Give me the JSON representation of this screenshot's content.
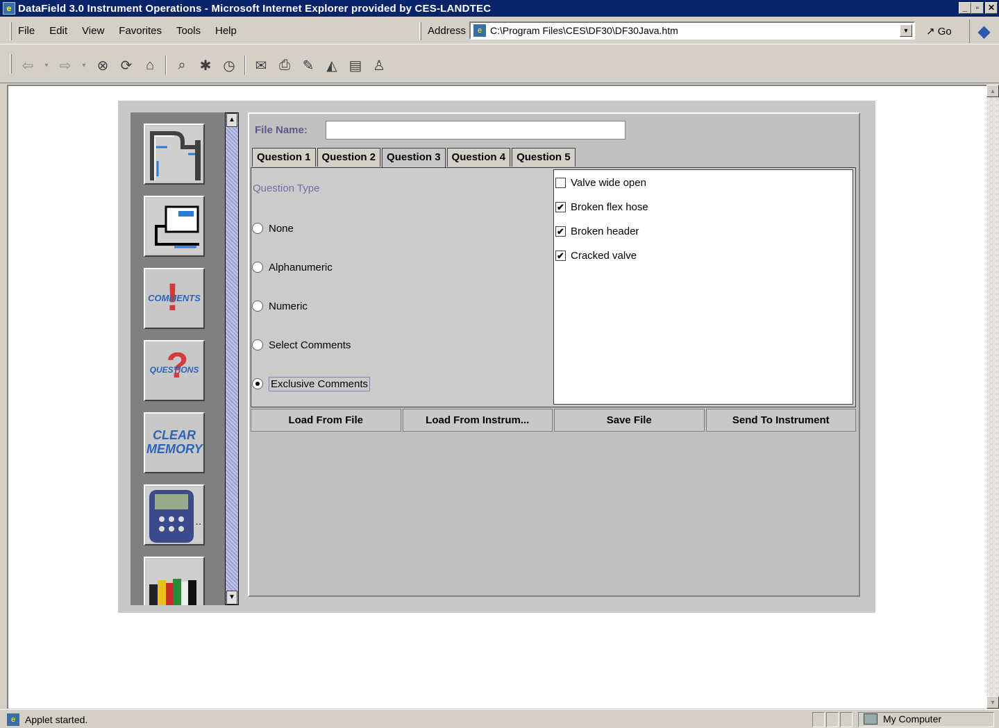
{
  "window": {
    "title": "DataField 3.0 Instrument Operations - Microsoft Internet Explorer provided by CES-LANDTEC",
    "buttons": [
      "_",
      "▫",
      "✕"
    ]
  },
  "menu": {
    "items": [
      "File",
      "Edit",
      "View",
      "Favorites",
      "Tools",
      "Help"
    ]
  },
  "address": {
    "label": "Address",
    "value": "C:\\Program Files\\CES\\DF30\\DF30Java.htm",
    "go_label": "Go"
  },
  "toolbar": {
    "icons": [
      "back-icon",
      "forward-icon",
      "stop-icon",
      "refresh-icon",
      "home-icon",
      "search-icon",
      "favorites-icon",
      "history-icon",
      "mail-icon",
      "print-icon",
      "edit-icon",
      "discuss-icon",
      "messenger-icon",
      "user-icon"
    ]
  },
  "sidebar": {
    "items": [
      {
        "icon": "pipe-diagram-icon",
        "label": ""
      },
      {
        "icon": "monitor-pipe-icon",
        "label": ""
      },
      {
        "icon": "comments-icon",
        "label": "COMMENTS"
      },
      {
        "icon": "questions-icon",
        "label": "QUESTIONS"
      },
      {
        "icon": "clear-memory-icon",
        "label": "CLEAR MEMORY"
      },
      {
        "icon": "instrument-device-icon",
        "label": ""
      },
      {
        "icon": "books-icon",
        "label": ""
      }
    ]
  },
  "form": {
    "file_name_label": "File Name:",
    "file_name_value": "",
    "tabs": [
      "Question 1",
      "Question 2",
      "Question 3",
      "Question 4",
      "Question 5"
    ],
    "active_tab": "Question 3",
    "question_type_label": "Question Type",
    "question_types": [
      {
        "label": "None",
        "checked": false
      },
      {
        "label": "Alphanumeric",
        "checked": false
      },
      {
        "label": "Numeric",
        "checked": false
      },
      {
        "label": "Select Comments",
        "checked": false
      },
      {
        "label": "Exclusive Comments",
        "checked": true
      }
    ],
    "comments": [
      {
        "label": "Valve wide open",
        "checked": false
      },
      {
        "label": "Broken flex hose",
        "checked": true
      },
      {
        "label": "Broken header",
        "checked": true
      },
      {
        "label": "Cracked valve",
        "checked": true
      }
    ],
    "actions": [
      "Load From File",
      "Load From Instrum...",
      "Save File",
      "Send To Instrument"
    ]
  },
  "status": {
    "text": "Applet started.",
    "zone": "My Computer"
  }
}
